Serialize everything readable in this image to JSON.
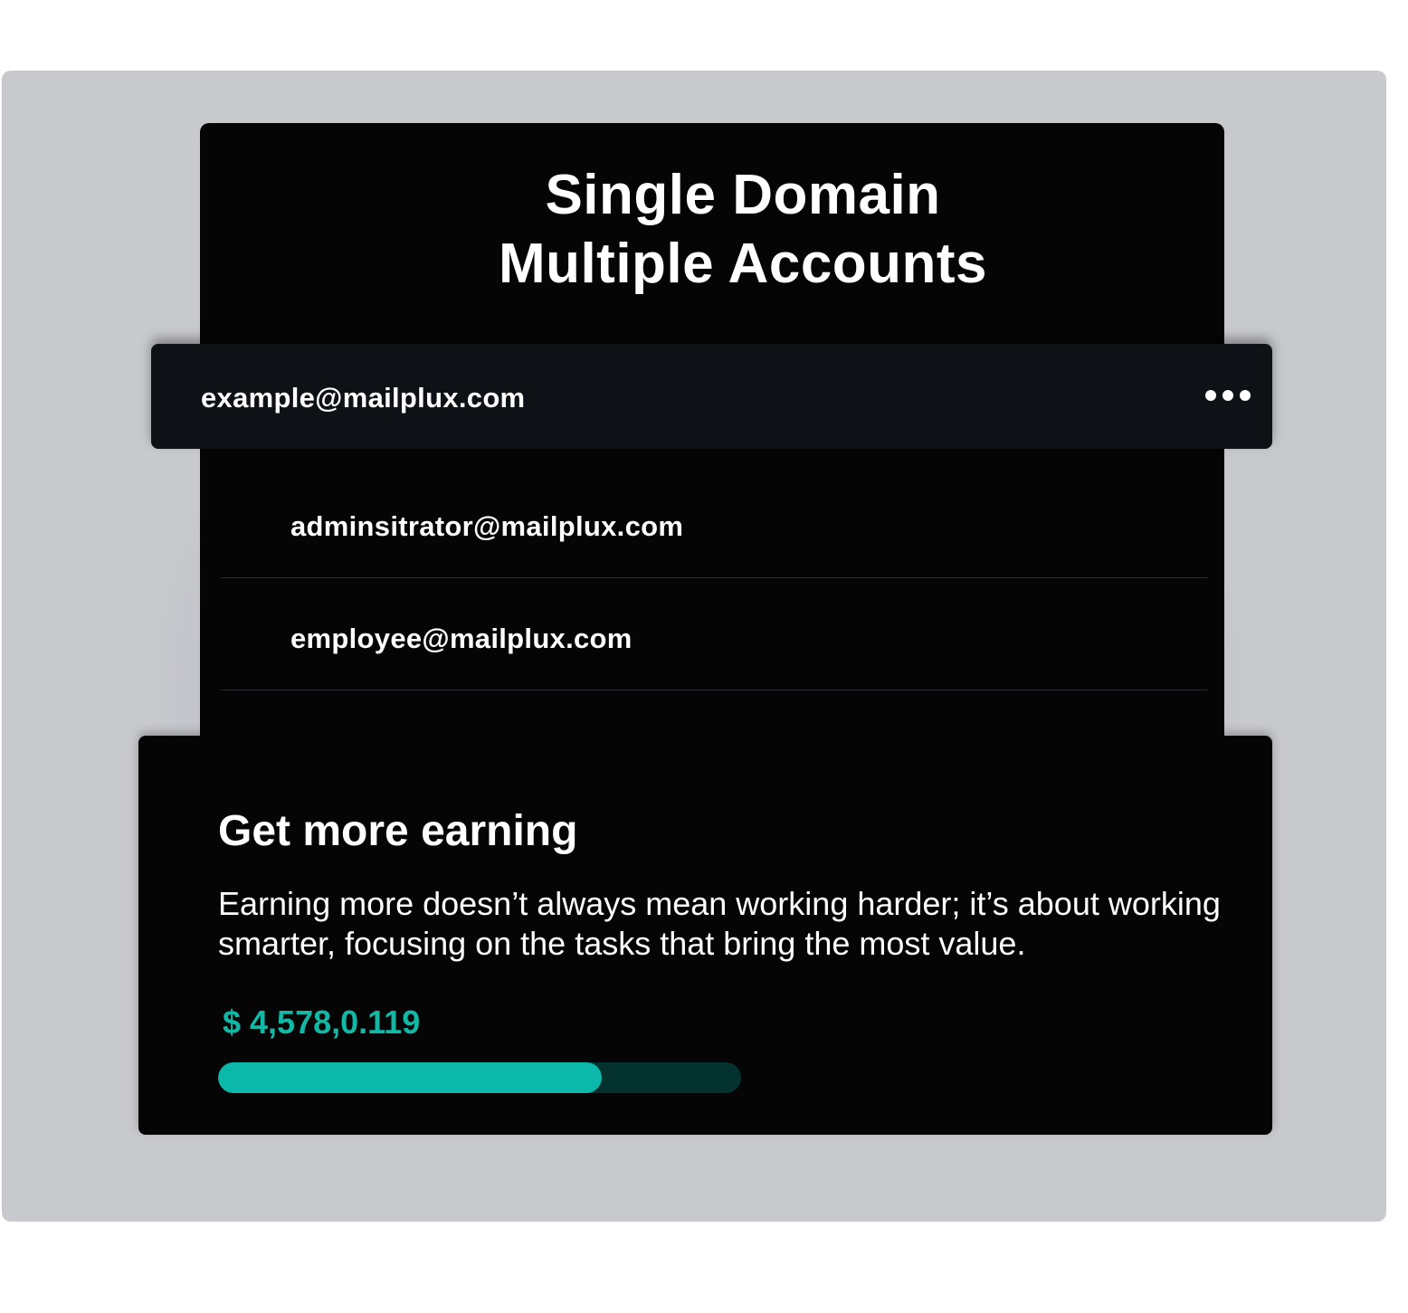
{
  "header": {
    "title_line1": "Single Domain",
    "title_line2": "Multiple Accounts"
  },
  "primary_account": {
    "email": "example@mailplux.com",
    "menu_icon": "more-horizontal-icon"
  },
  "accounts": [
    {
      "email": "adminsitrator@mailplux.com"
    },
    {
      "email": "employee@mailplux.com"
    }
  ],
  "earning": {
    "title": "Get more earning",
    "description": "Earning more doesn’t always mean working harder; it’s about working smarter, focusing on the tasks that bring the most value.",
    "amount": "$ 4,578,0.119",
    "progress_fraction": 0.733
  },
  "colors": {
    "accent": "#0bb8a9",
    "progress_track": "#04332f",
    "card_bg": "#050505",
    "row_bg": "#0e1115",
    "panel_bg": "#c8c9cc"
  }
}
